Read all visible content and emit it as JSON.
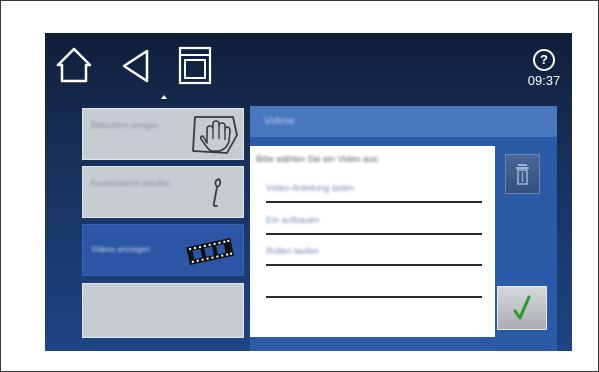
{
  "header": {
    "home_icon": "home-icon",
    "back_icon": "back-icon",
    "oven_icon": "oven-icon",
    "help_label": "?",
    "clock": "09:37"
  },
  "menu": {
    "items": [
      {
        "label": "Bildschirm reinigen",
        "icon": "hand-wipe-icon"
      },
      {
        "label": "Kundendienst anrufen",
        "icon": "wrench-icon"
      },
      {
        "label": "Videos anzeigen",
        "icon": "film-strip-icon"
      },
      {
        "label": "",
        "icon": ""
      }
    ]
  },
  "panel": {
    "title": "Videos",
    "list_title": "Bitte wählen Sie ein Video aus:",
    "options": [
      "Video-Anleitung laden",
      "Ein aufbauen",
      "Rollen laufen",
      ""
    ]
  },
  "actions": {
    "delete_icon": "trash-icon",
    "confirm_icon": "checkmark-icon"
  },
  "colors": {
    "screen_bg": "#18305a",
    "panel": "#2b5aa6",
    "active_item": "#2a56a5",
    "confirm_check": "#2e9a2e"
  }
}
